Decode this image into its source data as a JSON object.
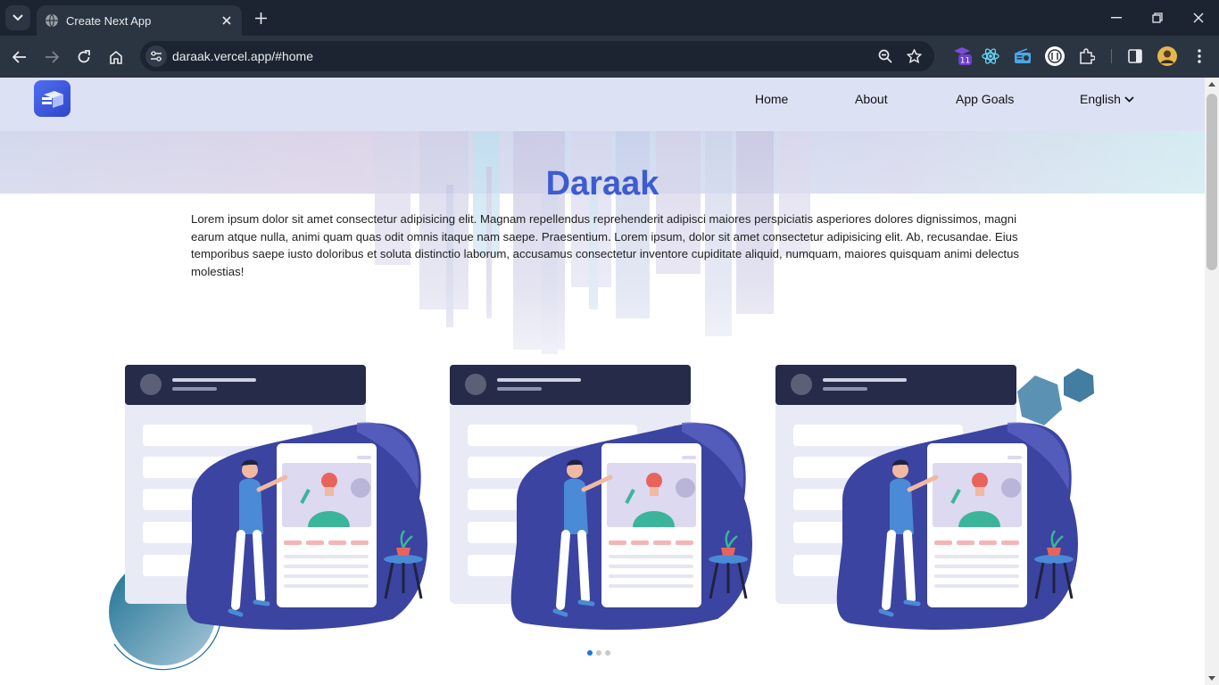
{
  "browser": {
    "tab_title": "Create Next App",
    "url": "daraak.vercel.app/#home",
    "extension_badge": "11"
  },
  "nav": {
    "home": "Home",
    "about": "About",
    "app_goals": "App Goals",
    "language": "English"
  },
  "hero": {
    "title": "Daraak",
    "text": "Lorem ipsum dolor sit amet consectetur adipisicing elit. Magnam repellendus reprehenderit adipisci maiores perspiciatis asperiores dolores dignissimos, magni earum atque nulla, animi quam quas odit omnis itaque nam saepe. Praesentium. Lorem ipsum, dolor sit amet consectetur adipisicing elit. Ab, recusandae. Eius temporibus saepe iusto doloribus et soluta distinctio laborum, accusamus consectetur inventore cupiditate aliquid, numquam, maiores quisquam animi delectus molestias!"
  },
  "carousel": {
    "slides": [
      "slide-1",
      "slide-2",
      "slide-3"
    ],
    "active_index": 0
  },
  "colors": {
    "accent": "#3f5bd0",
    "header_bg": "#dde1f4",
    "card_dark": "#262b4a",
    "blob": "#3b44a0"
  }
}
